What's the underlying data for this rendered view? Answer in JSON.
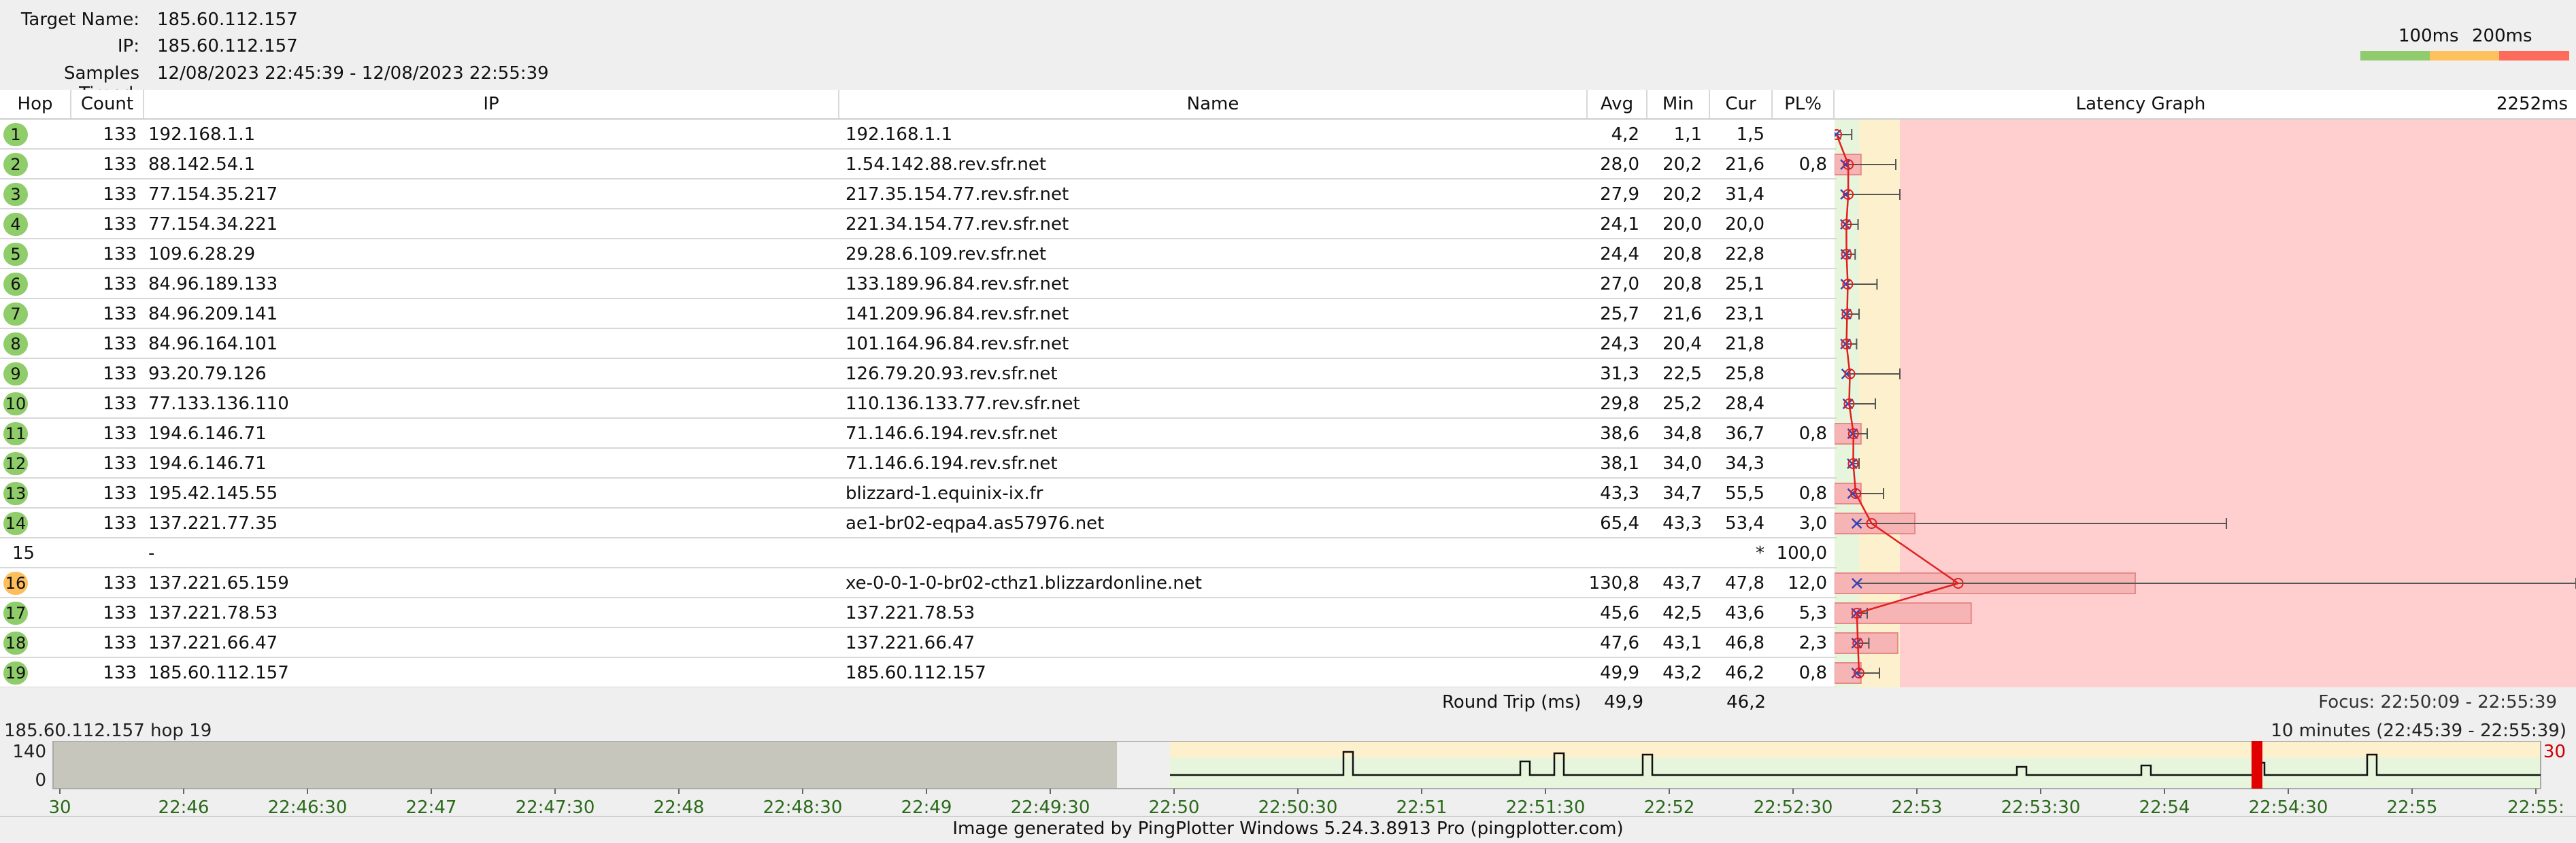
{
  "header": {
    "target_name_label": "Target Name:",
    "target_name": "185.60.112.157",
    "ip_label": "IP:",
    "ip": "185.60.112.157",
    "samples_label": "Samples Timed:",
    "samples": "12/08/2023 22:45:39 - 12/08/2023 22:55:39",
    "legend_100": "100ms",
    "legend_200": "200ms"
  },
  "colors": {
    "good": "#90cc6e",
    "warn": "#ffc05e",
    "bad": "#ff6b5b",
    "zone_good": "#e6f5dc",
    "zone_warn": "#fdf0cc",
    "zone_bad": "#ffcfcf",
    "badge_green": "#8fcc6a",
    "badge_orange": "#ffbe5c"
  },
  "columns": {
    "hop": "Hop",
    "count": "Count",
    "ip": "IP",
    "name": "Name",
    "avg": "Avg",
    "min": "Min",
    "cur": "Cur",
    "pl": "PL%",
    "graph": "Latency Graph",
    "graph_max": "2252ms"
  },
  "hops": [
    {
      "hop": "1",
      "count": "133",
      "ip": "192.168.1.1",
      "name": "192.168.1.1",
      "avg": "4,2",
      "min": "1,1",
      "cur": "1,5",
      "pl": "",
      "badge": "green",
      "avg_ms": 4.2,
      "min_ms": 1.1,
      "max_ms": 35,
      "loss": 0
    },
    {
      "hop": "2",
      "count": "133",
      "ip": "88.142.54.1",
      "name": "1.54.142.88.rev.sfr.net",
      "avg": "28,0",
      "min": "20,2",
      "cur": "21,6",
      "pl": "0,8",
      "badge": "green",
      "avg_ms": 28.0,
      "min_ms": 20.2,
      "max_ms": 95,
      "loss": 0.8
    },
    {
      "hop": "3",
      "count": "133",
      "ip": "77.154.35.217",
      "name": "217.35.154.77.rev.sfr.net",
      "avg": "27,9",
      "min": "20,2",
      "cur": "31,4",
      "pl": "",
      "badge": "green",
      "avg_ms": 27.9,
      "min_ms": 20.2,
      "max_ms": 100,
      "loss": 0
    },
    {
      "hop": "4",
      "count": "133",
      "ip": "77.154.34.221",
      "name": "221.34.154.77.rev.sfr.net",
      "avg": "24,1",
      "min": "20,0",
      "cur": "20,0",
      "pl": "",
      "badge": "green",
      "avg_ms": 24.1,
      "min_ms": 20.0,
      "max_ms": 48,
      "loss": 0
    },
    {
      "hop": "5",
      "count": "133",
      "ip": "109.6.28.29",
      "name": "29.28.6.109.rev.sfr.net",
      "avg": "24,4",
      "min": "20,8",
      "cur": "22,8",
      "pl": "",
      "badge": "green",
      "avg_ms": 24.4,
      "min_ms": 20.8,
      "max_ms": 42,
      "loss": 0
    },
    {
      "hop": "6",
      "count": "133",
      "ip": "84.96.189.133",
      "name": "133.189.96.84.rev.sfr.net",
      "avg": "27,0",
      "min": "20,8",
      "cur": "25,1",
      "pl": "",
      "badge": "green",
      "avg_ms": 27.0,
      "min_ms": 20.8,
      "max_ms": 72,
      "loss": 0
    },
    {
      "hop": "7",
      "count": "133",
      "ip": "84.96.209.141",
      "name": "141.209.96.84.rev.sfr.net",
      "avg": "25,7",
      "min": "21,6",
      "cur": "23,1",
      "pl": "",
      "badge": "green",
      "avg_ms": 25.7,
      "min_ms": 21.6,
      "max_ms": 50,
      "loss": 0
    },
    {
      "hop": "8",
      "count": "133",
      "ip": "84.96.164.101",
      "name": "101.164.96.84.rev.sfr.net",
      "avg": "24,3",
      "min": "20,4",
      "cur": "21,8",
      "pl": "",
      "badge": "green",
      "avg_ms": 24.3,
      "min_ms": 20.4,
      "max_ms": 45,
      "loss": 0
    },
    {
      "hop": "9",
      "count": "133",
      "ip": "93.20.79.126",
      "name": "126.79.20.93.rev.sfr.net",
      "avg": "31,3",
      "min": "22,5",
      "cur": "25,8",
      "pl": "",
      "badge": "green",
      "avg_ms": 31.3,
      "min_ms": 22.5,
      "max_ms": 100,
      "loss": 0
    },
    {
      "hop": "10",
      "count": "133",
      "ip": "77.133.136.110",
      "name": "110.136.133.77.rev.sfr.net",
      "avg": "29,8",
      "min": "25,2",
      "cur": "28,4",
      "pl": "",
      "badge": "green",
      "avg_ms": 29.8,
      "min_ms": 25.2,
      "max_ms": 70,
      "loss": 0
    },
    {
      "hop": "11",
      "count": "133",
      "ip": "194.6.146.71",
      "name": "71.146.6.194.rev.sfr.net",
      "avg": "38,6",
      "min": "34,8",
      "cur": "36,7",
      "pl": "0,8",
      "badge": "green",
      "avg_ms": 38.6,
      "min_ms": 34.8,
      "max_ms": 60,
      "loss": 0.8
    },
    {
      "hop": "12",
      "count": "133",
      "ip": "194.6.146.71",
      "name": "71.146.6.194.rev.sfr.net",
      "avg": "38,1",
      "min": "34,0",
      "cur": "34,3",
      "pl": "",
      "badge": "green",
      "avg_ms": 38.1,
      "min_ms": 34.0,
      "max_ms": 50,
      "loss": 0
    },
    {
      "hop": "13",
      "count": "133",
      "ip": "195.42.145.55",
      "name": "blizzard-1.equinix-ix.fr",
      "avg": "43,3",
      "min": "34,7",
      "cur": "55,5",
      "pl": "0,8",
      "badge": "green",
      "avg_ms": 43.3,
      "min_ms": 34.7,
      "max_ms": 80,
      "loss": 0.8
    },
    {
      "hop": "14",
      "count": "133",
      "ip": "137.221.77.35",
      "name": "ae1-br02-eqpa4.as57976.net",
      "avg": "65,4",
      "min": "43,3",
      "cur": "53,4",
      "pl": "3,0",
      "badge": "green",
      "avg_ms": 65.4,
      "min_ms": 43.3,
      "max_ms": 450,
      "loss": 3.0
    },
    {
      "hop": "15",
      "count": "",
      "ip": "-",
      "name": "",
      "avg": "",
      "min": "",
      "cur": "*",
      "pl": "100,0",
      "badge": "none",
      "avg_ms": null,
      "min_ms": null,
      "max_ms": null,
      "loss": 100
    },
    {
      "hop": "16",
      "count": "133",
      "ip": "137.221.65.159",
      "name": "xe-0-0-1-0-br02-cthz1.blizzardonline.net",
      "avg": "130,8",
      "min": "43,7",
      "cur": "47,8",
      "pl": "12,0",
      "badge": "orange",
      "avg_ms": 130.8,
      "min_ms": 43.7,
      "max_ms": 2252,
      "loss": 12.0
    },
    {
      "hop": "17",
      "count": "133",
      "ip": "137.221.78.53",
      "name": "137.221.78.53",
      "avg": "45,6",
      "min": "42,5",
      "cur": "43,6",
      "pl": "5,3",
      "badge": "green",
      "avg_ms": 45.6,
      "min_ms": 42.5,
      "max_ms": 60,
      "loss": 5.3
    },
    {
      "hop": "18",
      "count": "133",
      "ip": "137.221.66.47",
      "name": "137.221.66.47",
      "avg": "47,6",
      "min": "43,1",
      "cur": "46,8",
      "pl": "2,3",
      "badge": "green",
      "avg_ms": 47.6,
      "min_ms": 43.1,
      "max_ms": 62,
      "loss": 2.3
    },
    {
      "hop": "19",
      "count": "133",
      "ip": "185.60.112.157",
      "name": "185.60.112.157",
      "avg": "49,9",
      "min": "43,2",
      "cur": "46,2",
      "pl": "0,8",
      "badge": "green",
      "avg_ms": 49.9,
      "min_ms": 43.2,
      "max_ms": 75,
      "loss": 0.8
    }
  ],
  "round_trip": {
    "label": "Round Trip (ms)",
    "avg": "49,9",
    "cur": "46,2",
    "focus": "Focus: 22:50:09 - 22:55:39"
  },
  "timeline": {
    "left_label": "185.60.112.157 hop 19",
    "right_label": "10 minutes (22:45:39 - 22:55:39)",
    "y_max": "140",
    "y_min": "0",
    "loss_value": "30",
    "tick_labels": [
      "30",
      "22:46",
      "22:46:30",
      "22:47",
      "22:47:30",
      "22:48",
      "22:48:30",
      "22:49",
      "22:49:30",
      "22:50",
      "22:50:30",
      "22:51",
      "22:51:30",
      "22:52",
      "22:52:30",
      "22:53",
      "22:53:30",
      "22:54",
      "22:54:30",
      "22:55",
      "22:55:"
    ]
  },
  "footer": "Image generated by PingPlotter Windows 5.24.3.8913 Pro (pingplotter.com)"
}
